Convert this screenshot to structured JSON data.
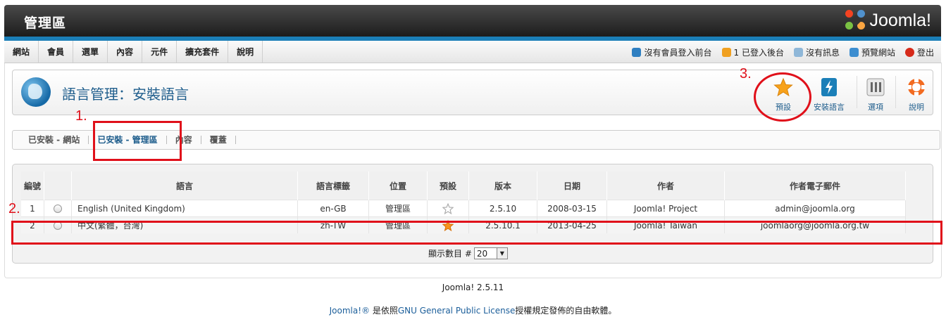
{
  "header": {
    "title": "管理區",
    "logo_text": "Joomla!"
  },
  "menu": [
    "網站",
    "會員",
    "選單",
    "內容",
    "元件",
    "擴充套件",
    "說明"
  ],
  "status": [
    {
      "icon": "users-icon",
      "label": "沒有會員登入前台"
    },
    {
      "icon": "admin-user-icon",
      "label": "1 已登入後台"
    },
    {
      "icon": "message-icon",
      "label": "沒有訊息"
    },
    {
      "icon": "preview-icon",
      "label": "預覽網站"
    },
    {
      "icon": "logout-icon",
      "label": "登出"
    }
  ],
  "page": {
    "title": "語言管理：安裝語言"
  },
  "toolbar": {
    "default": "預設",
    "install": "安裝語言",
    "options": "選項",
    "help": "說明"
  },
  "tabs": [
    "已安裝 - 網站",
    "已安裝 - 管理區",
    "內容",
    "覆蓋"
  ],
  "table": {
    "headers": [
      "編號",
      "",
      "語言",
      "語言標籤",
      "位置",
      "預設",
      "版本",
      "日期",
      "作者",
      "作者電子郵件"
    ],
    "rows": [
      {
        "num": "1",
        "lang": "English (United Kingdom)",
        "tag": "en-GB",
        "loc": "管理區",
        "default": false,
        "ver": "2.5.10",
        "date": "2008-03-15",
        "author": "Joomla! Project",
        "email": "admin@joomla.org"
      },
      {
        "num": "2",
        "lang": "中文(繁體，台灣)",
        "tag": "zh-TW",
        "loc": "管理區",
        "default": true,
        "ver": "2.5.10.1",
        "date": "2013-04-25",
        "author": "Joomla! Taiwan",
        "email": "joomlaorg@joomla.org.tw"
      }
    ]
  },
  "pager": {
    "label": "顯示數目 #",
    "value": "20"
  },
  "footer": {
    "version": "Joomla! 2.5.11",
    "brand": "Joomla!®",
    "text1": " 是依照",
    "license": "GNU General Public License",
    "text2": "授權規定發佈的自由軟體。"
  },
  "annotations": [
    "1.",
    "2.",
    "3."
  ],
  "colors": {
    "accent": "#1b7fb8",
    "annotation": "#e0101a",
    "title": "#1e5d8c"
  }
}
